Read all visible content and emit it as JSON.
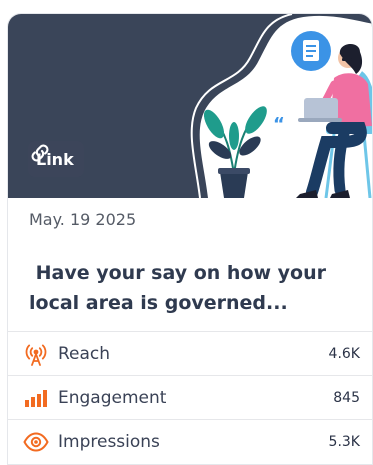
{
  "post": {
    "badge_label": "Link",
    "date": "May. 19 2025",
    "title": " Have your say on how your local area is governed..."
  },
  "metrics": [
    {
      "label": "Reach",
      "value": "4.6K",
      "icon": "broadcast-tower-icon"
    },
    {
      "label": "Engagement",
      "value": "845",
      "icon": "bar-chart-icon"
    },
    {
      "label": "Impressions",
      "value": "5.3K",
      "icon": "eye-icon"
    }
  ],
  "colors": {
    "hero_bg": "#3a4559",
    "accent_orange": "#f26b21",
    "badge_bg": "#3c455a",
    "doc_bubble": "#3b93e6",
    "shirt": "#f06fa1",
    "plant": "#1f9c8c"
  }
}
